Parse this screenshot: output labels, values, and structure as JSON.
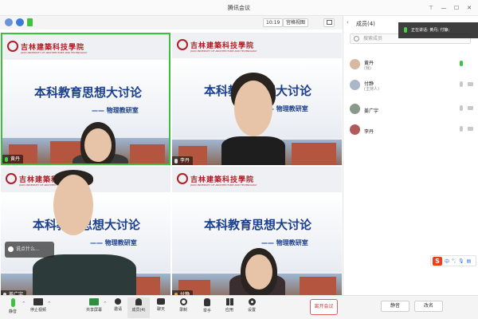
{
  "window": {
    "title": "腾讯会议"
  },
  "toolbar": {
    "time": "10:19",
    "view": "宫格视图"
  },
  "tiles": [
    {
      "heading": "本科教育思想大讨论",
      "subheading": "—— 物理教研室",
      "logo_cn": "吉林建築科技學院",
      "logo_en": "JILIN UNIVERSITY OF ARCHITECTURE AND TECHNOLOGY",
      "name": "黄丹",
      "mic": "on",
      "active": true
    },
    {
      "heading": "本科教育思想大讨论",
      "subheading": "—— 物理教研室",
      "logo_cn": "吉林建築科技學院",
      "logo_en": "JILIN UNIVERSITY OF ARCHITECTURE AND TECHNOLOGY",
      "name": "李丹",
      "mic": "off",
      "active": false
    },
    {
      "heading": "本科教育思想大讨论",
      "subheading": "—— 物理教研室",
      "logo_cn": "吉林建築科技學院",
      "logo_en": "JILIN UNIVERSITY OF ARCHITECTURE AND TECHNOLOGY",
      "name": "姜广宇",
      "mic": "off",
      "active": false
    },
    {
      "heading": "本科教育思想大讨论",
      "subheading": "—— 物理教研室",
      "logo_cn": "吉林建築科技學院",
      "logo_en": "JILIN UNIVERSITY OF ARCHITECTURE AND TECHNOLOGY",
      "name": "付静",
      "mic": "off",
      "active": false
    }
  ],
  "chat_input": {
    "placeholder": "说点什么..."
  },
  "panel": {
    "title": "成员(4)",
    "search_placeholder": "搜索成员",
    "members": [
      {
        "name": "黄丹",
        "role": "(我)",
        "mic": "on"
      },
      {
        "name": "付静",
        "role": "(主持人)",
        "mic": "off"
      },
      {
        "name": "姜广宇",
        "role": "",
        "mic": "off"
      },
      {
        "name": "李丹",
        "role": "",
        "mic": "off"
      }
    ],
    "mute_all": "静音",
    "rename": "改名"
  },
  "speaking": {
    "text": "正在讲话: 黄丹; 付静;"
  },
  "ime": {
    "s": "S",
    "zh": "中",
    "punct": "°,"
  },
  "bottom": {
    "mute": "静音",
    "stop_video": "停止视频",
    "share": "共享屏幕",
    "invite": "邀请",
    "members": "成员(4)",
    "chat": "聊天",
    "record": "录制",
    "raise_hand": "举手",
    "apps": "应用",
    "settings": "设置",
    "leave": "离开会议"
  },
  "colors": {
    "accent_green": "#41c141",
    "heading_blue": "#1b3f8f",
    "logo_red": "#b11f24",
    "leave_red": "#d63a3a"
  }
}
